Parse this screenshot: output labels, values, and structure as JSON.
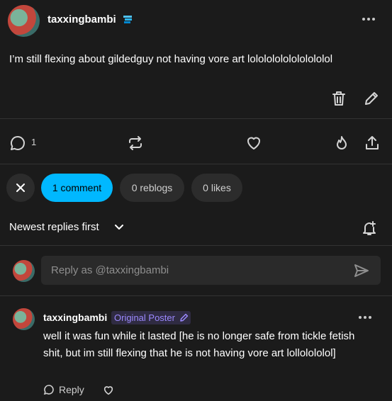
{
  "post": {
    "username": "taxxingbambi",
    "body": "I’m still flexing about gildedguy not having vore art lolololololololololol",
    "reply_count": "1"
  },
  "tabs": {
    "comments": "1 comment",
    "reblogs": "0 reblogs",
    "likes": "0 likes"
  },
  "sort": {
    "label": "Newest replies first"
  },
  "reply_box": {
    "placeholder": "Reply as @taxxingbambi"
  },
  "comment": {
    "username": "taxxingbambi",
    "badge": "Original Poster",
    "text": "well it was fun while it lasted [he is no longer safe from tickle fetish shit, but im still flexing that he is not having vore art lollolololol]",
    "reply_label": "Reply"
  },
  "colors": {
    "background": "#1b1b1b",
    "accent": "#00b8ff",
    "op_badge_text": "#9c89ff"
  }
}
